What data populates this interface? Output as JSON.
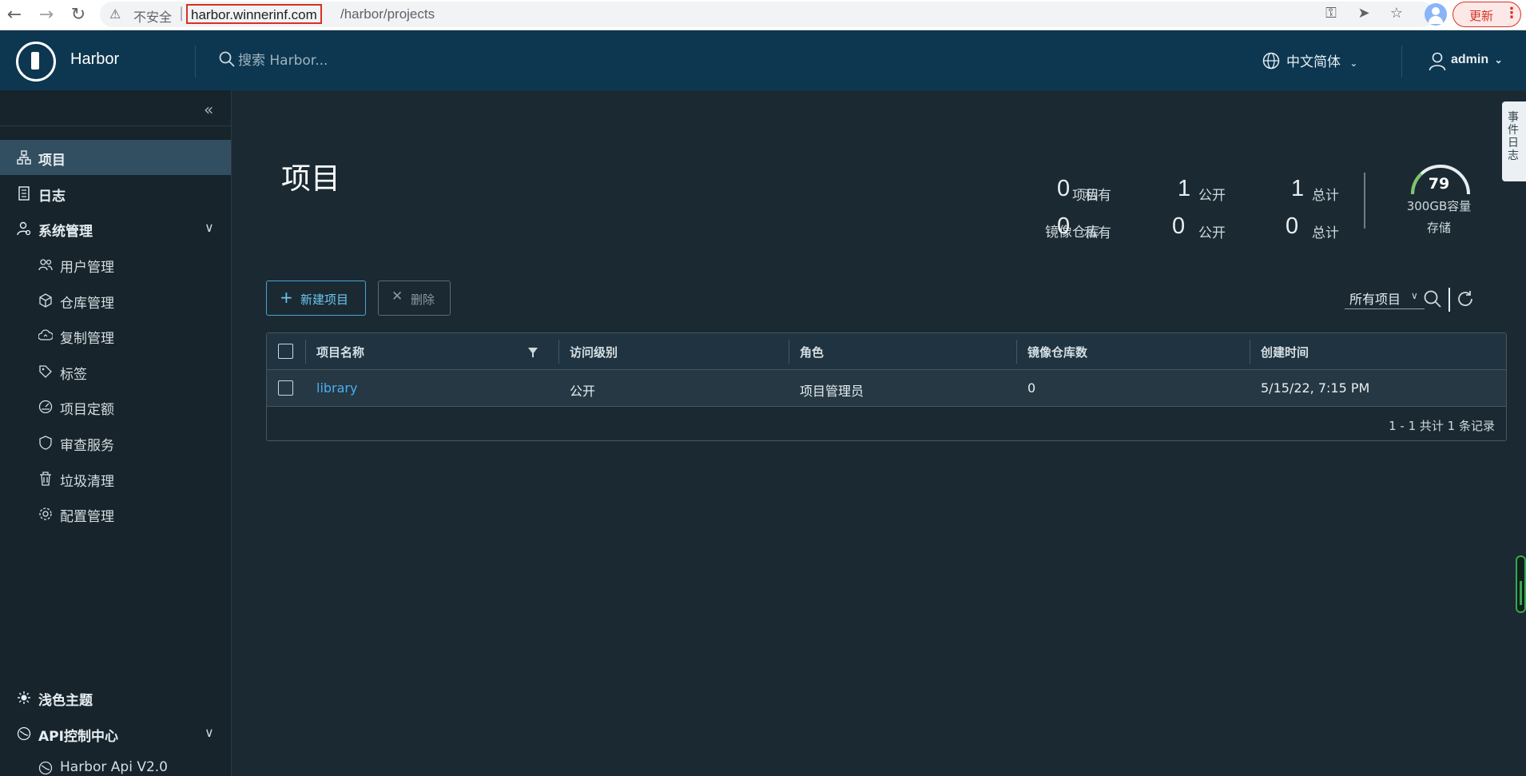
{
  "browser": {
    "insecure_label": "不安全",
    "url_host": "harbor.winnerinf.com",
    "url_path": "/harbor/projects",
    "update_label": "更新"
  },
  "header": {
    "brand": "Harbor",
    "search_placeholder": "搜索 Harbor...",
    "language": "中文简体",
    "user": "admin"
  },
  "sidebar": {
    "items": [
      {
        "label": "项目",
        "icon": "projects-icon"
      },
      {
        "label": "日志",
        "icon": "logs-icon"
      },
      {
        "label": "系统管理",
        "icon": "admin-icon"
      },
      {
        "label": "用户管理",
        "icon": "users-icon"
      },
      {
        "label": "仓库管理",
        "icon": "registry-icon"
      },
      {
        "label": "复制管理",
        "icon": "replication-icon"
      },
      {
        "label": "标签",
        "icon": "tag-icon"
      },
      {
        "label": "项目定额",
        "icon": "quota-icon"
      },
      {
        "label": "审查服务",
        "icon": "shield-icon"
      },
      {
        "label": "垃圾清理",
        "icon": "trash-icon"
      },
      {
        "label": "配置管理",
        "icon": "gear-icon"
      }
    ],
    "theme_label": "浅色主题",
    "api_center_label": "API控制中心",
    "api_item_label": "Harbor Api V2.0"
  },
  "main": {
    "title": "项目",
    "stats": {
      "projects_label": "项目",
      "repos_label": "镜像仓库",
      "private_label": "私有",
      "public_label": "公开",
      "total_label": "总计",
      "projects_private": "0",
      "projects_public": "1",
      "projects_total": "1",
      "repos_private": "0",
      "repos_public": "0",
      "repos_total": "0",
      "storage_value": "79",
      "storage_capacity": "300GB容量",
      "storage_label": "存储",
      "storage_fraction": 0.26
    },
    "new_project_label": "新建项目",
    "delete_label": "删除",
    "filter_selected": "所有项目",
    "table": {
      "columns": [
        "项目名称",
        "访问级别",
        "角色",
        "镜像仓库数",
        "创建时间"
      ],
      "rows": [
        {
          "name": "library",
          "access": "公开",
          "role": "项目管理员",
          "repo_count": "0",
          "created": "5/15/22, 7:15 PM"
        }
      ],
      "footer": "1 - 1 共计 1 条记录"
    },
    "side_tab": "事件日志"
  },
  "colors": {
    "header_bg": "#0d3750",
    "sidebar_bg": "#17242b",
    "main_bg": "#1b2a32",
    "active_bg": "#324f61",
    "link": "#4aaef0",
    "gauge": "#7ec36b"
  }
}
